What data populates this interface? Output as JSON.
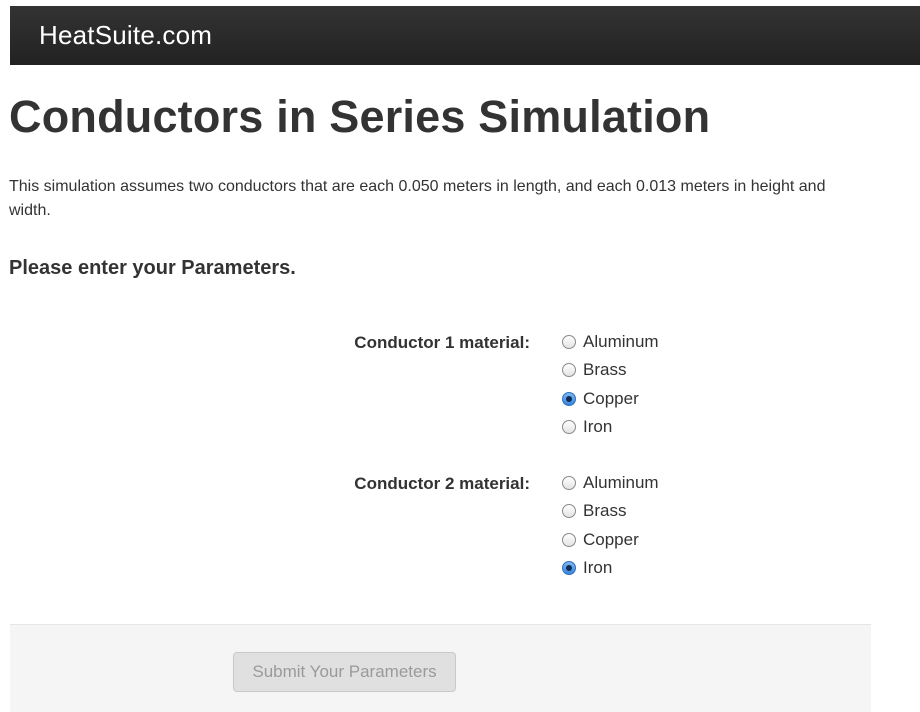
{
  "navbar": {
    "brand": "HeatSuite.com"
  },
  "main": {
    "title": "Conductors in Series Simulation",
    "intro": "This simulation assumes two conductors that are each 0.050 meters in length, and each 0.013 meters in height and width.",
    "section_heading": "Please enter your Parameters."
  },
  "form": {
    "conductor1": {
      "label": "Conductor 1 material:",
      "selected": "Copper",
      "options": [
        {
          "label": "Aluminum",
          "checked": false
        },
        {
          "label": "Brass",
          "checked": false
        },
        {
          "label": "Copper",
          "checked": true
        },
        {
          "label": "Iron",
          "checked": false
        }
      ]
    },
    "conductor2": {
      "label": "Conductor 2 material:",
      "selected": "Iron",
      "options": [
        {
          "label": "Aluminum",
          "checked": false
        },
        {
          "label": "Brass",
          "checked": false
        },
        {
          "label": "Copper",
          "checked": false
        },
        {
          "label": "Iron",
          "checked": true
        }
      ]
    },
    "submit_label": "Submit Your Parameters",
    "submit_disabled": true
  },
  "colors": {
    "navbar": "#222222",
    "radio_checked": "#3a84d8",
    "actions_background": "#f5f5f5"
  }
}
